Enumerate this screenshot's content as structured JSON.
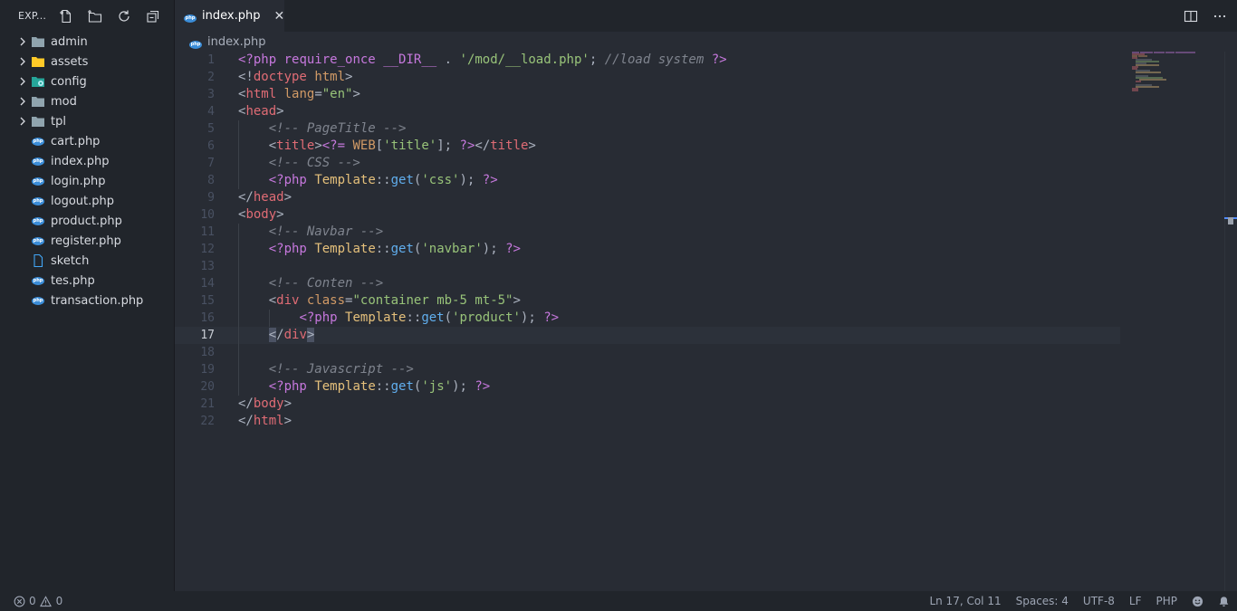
{
  "sidebar": {
    "title": "EXP...",
    "items": [
      {
        "label": "admin",
        "type": "folder"
      },
      {
        "label": "assets",
        "type": "folder"
      },
      {
        "label": "config",
        "type": "folder"
      },
      {
        "label": "mod",
        "type": "folder"
      },
      {
        "label": "tpl",
        "type": "folder"
      },
      {
        "label": "cart.php",
        "type": "php"
      },
      {
        "label": "index.php",
        "type": "php"
      },
      {
        "label": "login.php",
        "type": "php"
      },
      {
        "label": "logout.php",
        "type": "php"
      },
      {
        "label": "product.php",
        "type": "php"
      },
      {
        "label": "register.php",
        "type": "php"
      },
      {
        "label": "sketch",
        "type": "file"
      },
      {
        "label": "tes.php",
        "type": "php"
      },
      {
        "label": "transaction.php",
        "type": "php"
      }
    ]
  },
  "tab": {
    "label": "index.php",
    "close": "✕"
  },
  "breadcrumb": {
    "file": "index.php"
  },
  "editor": {
    "current_line": 17,
    "line_numbers": [
      "1",
      "2",
      "3",
      "4",
      "5",
      "6",
      "7",
      "8",
      "9",
      "10",
      "11",
      "12",
      "13",
      "14",
      "15",
      "16",
      "17",
      "18",
      "19",
      "20",
      "21",
      "22"
    ]
  },
  "status": {
    "errors": "0",
    "warnings": "0",
    "position": "Ln 17, Col 11",
    "spaces": "Spaces: 4",
    "encoding": "UTF-8",
    "eol": "LF",
    "language": "PHP"
  },
  "colors": {
    "accent": "#3b8dd8",
    "keyword": "#c678dd",
    "tag": "#e06c75",
    "string": "#98c379",
    "comment": "#7f848e",
    "class": "#e5c07b",
    "function": "#61afef"
  },
  "icons": [
    "new-file-icon",
    "new-folder-icon",
    "refresh-icon",
    "collapse-all-icon",
    "split-editor-icon",
    "more-actions-icon",
    "chevron-right-icon",
    "folder-icon",
    "php-file-icon",
    "file-icon",
    "error-icon",
    "warning-icon",
    "feedback-icon",
    "bell-icon"
  ]
}
